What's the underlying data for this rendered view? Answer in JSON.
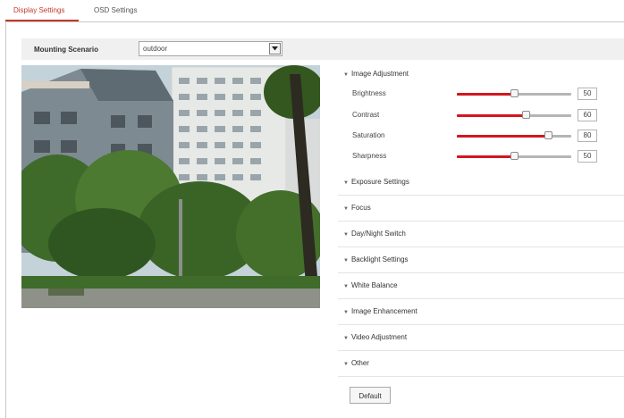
{
  "tabs": [
    {
      "label": "Display Settings",
      "active": true
    },
    {
      "label": "OSD Settings",
      "active": false
    }
  ],
  "scenario": {
    "label": "Mounting Scenario",
    "value": "outdoor"
  },
  "image_adjustment": {
    "title": "Image Adjustment",
    "sliders": [
      {
        "name": "Brightness",
        "value": "50",
        "level": 0.5
      },
      {
        "name": "Contrast",
        "value": "60",
        "level": 0.6
      },
      {
        "name": "Saturation",
        "value": "80",
        "level": 0.8
      },
      {
        "name": "Sharpness",
        "value": "50",
        "level": 0.5
      }
    ]
  },
  "sections": [
    "Exposure Settings",
    "Focus",
    "Day/Night Switch",
    "Backlight Settings",
    "White Balance",
    "Image Enhancement",
    "Video Adjustment",
    "Other"
  ],
  "default_button": "Default",
  "colors": {
    "accent": "#d3161e",
    "active_tab": "#c0392b"
  },
  "icons": {
    "section_caret": "caret-down-icon",
    "select_arrow": "dropdown-arrow-icon"
  }
}
